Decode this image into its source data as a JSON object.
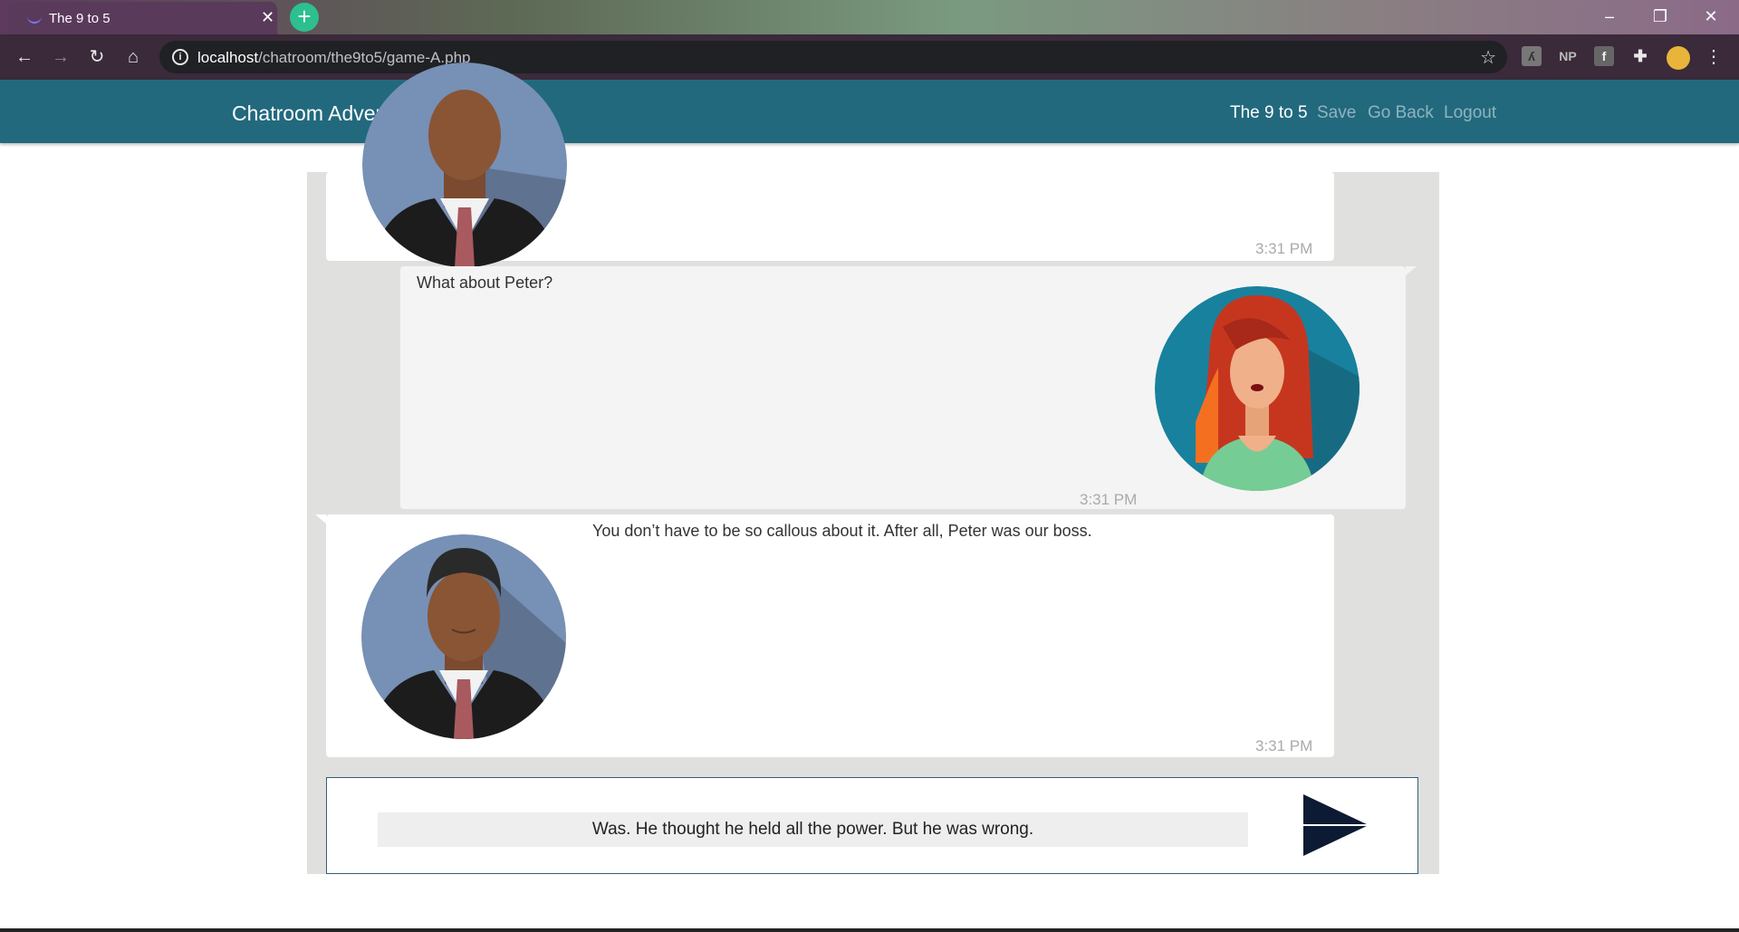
{
  "browser": {
    "tab_title": "The 9 to 5",
    "tab_close": "✕",
    "new_tab": "+",
    "url_host": "localhost",
    "url_path": "/chatroom/the9to5/game-A.php",
    "window_controls": {
      "minimize": "–",
      "restore": "❐",
      "close": "✕"
    },
    "extensions": [
      "NP",
      "f"
    ]
  },
  "site": {
    "brand": "Chatroom Adventures",
    "nav": {
      "current": "The 9 to 5",
      "save": "Save",
      "go_back": "Go Back",
      "logout": "Logout"
    }
  },
  "colors": {
    "navbar": "#22697e",
    "chat_panel": "#e0e0de",
    "send_arrow": "#0d1a33"
  },
  "messages": [
    {
      "sender": "male-coworker",
      "side": "left",
      "text": "",
      "time": "3:31 PM",
      "avatar": "man-in-suit-avatar"
    },
    {
      "sender": "player",
      "side": "right",
      "text": "What about Peter?",
      "time": "3:31 PM",
      "avatar": "red-haired-woman-avatar"
    },
    {
      "sender": "male-coworker",
      "side": "left",
      "text": "You don’t have to be so callous about it. After all, Peter was our boss.",
      "time": "3:31 PM",
      "avatar": "man-in-suit-avatar"
    }
  ],
  "composer": {
    "value": "Was. He thought he held all the power. But he was wrong."
  }
}
